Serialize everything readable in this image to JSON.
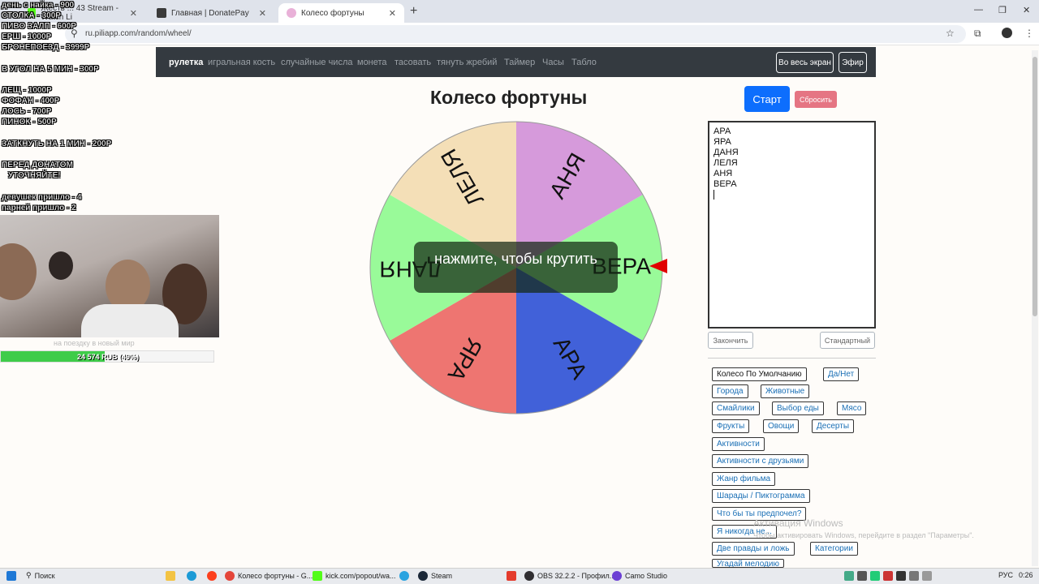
{
  "browser": {
    "tabs": [
      {
        "label": "Жесть ... 43 Stream - Watch Li",
        "active": false
      },
      {
        "label": "Главная | DonatePay",
        "active": false
      },
      {
        "label": "Колесо фортуны",
        "active": true
      }
    ],
    "url": "ru.piliapp.com/random/wheel/"
  },
  "nav": {
    "links": [
      "рулетка",
      "игральная кость",
      "случайные числа",
      "монета",
      "тасовать",
      "тянуть жребий",
      "Таймер",
      "Часы",
      "Табло"
    ],
    "fullscreen_label": "Во весь экран",
    "live_label": "Эфир"
  },
  "page": {
    "title": "Колесо фортуны",
    "start_label": "Старт",
    "reset_label": "Сбросить",
    "overlay_text": "нажмите, чтобы крутить"
  },
  "wheel": {
    "segments": [
      {
        "label": "АНЯ",
        "color": "#d69adb"
      },
      {
        "label": "ВЕРА",
        "color": "#99fa99"
      },
      {
        "label": "АРА",
        "color": "#4161d9"
      },
      {
        "label": "ЯРА",
        "color": "#ee7571"
      },
      {
        "label": "ДАНЯ",
        "color": "#99fa99"
      },
      {
        "label": "ЛЕЛЯ",
        "color": "#f4dfb7"
      }
    ],
    "pointer_color": "#e00000"
  },
  "names_list": [
    "АРА",
    "ЯРА",
    "ДАНЯ",
    "ЛЕЛЯ",
    "АНЯ",
    "ВЕРА"
  ],
  "controls": {
    "finish_label": "Закончить",
    "standard_label": "Стандартный"
  },
  "presets": [
    "Колесо По Умолчанию",
    "Да/Нет",
    "Города",
    "Животные",
    "Смайлики",
    "Выбор еды",
    "Мясо",
    "Фрукты",
    "Овощи",
    "Десерты",
    "Активности",
    "Активности с друзьями",
    "Жанр фильма",
    "Шарады / Пиктограмма",
    "Что бы ты предпочел?",
    "Я никогда не...",
    "Две правды и ложь",
    "Категории",
    "Угадай мелодию"
  ],
  "stream_overlay": {
    "lines": [
      "день с найка - 900",
      "СТОЛКА - 300Р",
      "ПИВО ЗАЛП - 600Р",
      "ЕРШ - 1000Р",
      "БРОНЕПОЕЗД - 3999Р",
      "В УГОЛ НА 5 МИН - 300Р",
      "ЛЕЩ - 1000Р",
      "ФОФАН - 400Р",
      "ЛОСЬ - 700Р",
      "ПИНОК - 500Р",
      "ЗАТКНУТЬ НА 1 МИН - 200Р",
      "ПЕРЕД ДОНАТОМ",
      "УТОЧНЯЙТЕ!",
      "девушек пришло - 4",
      "парней пришло - 2"
    ],
    "caption": "на поездку в новый мир",
    "progress_text": "24 574 RUB (49%)",
    "progress_percent": 49
  },
  "windows_watermark": {
    "title": "Активация Windows",
    "subtitle": "Чтобы активировать Windows, перейдите в раздел \"Параметры\"."
  },
  "taskbar": {
    "search_label": "Поиск",
    "items": [
      "Колесо фортуны - G...",
      "kick.com/popout/wa...",
      "Steam",
      "OBS 32.2.2 - Профил...",
      "Camo Studio"
    ],
    "lang": "РУС",
    "time": "0:26"
  }
}
